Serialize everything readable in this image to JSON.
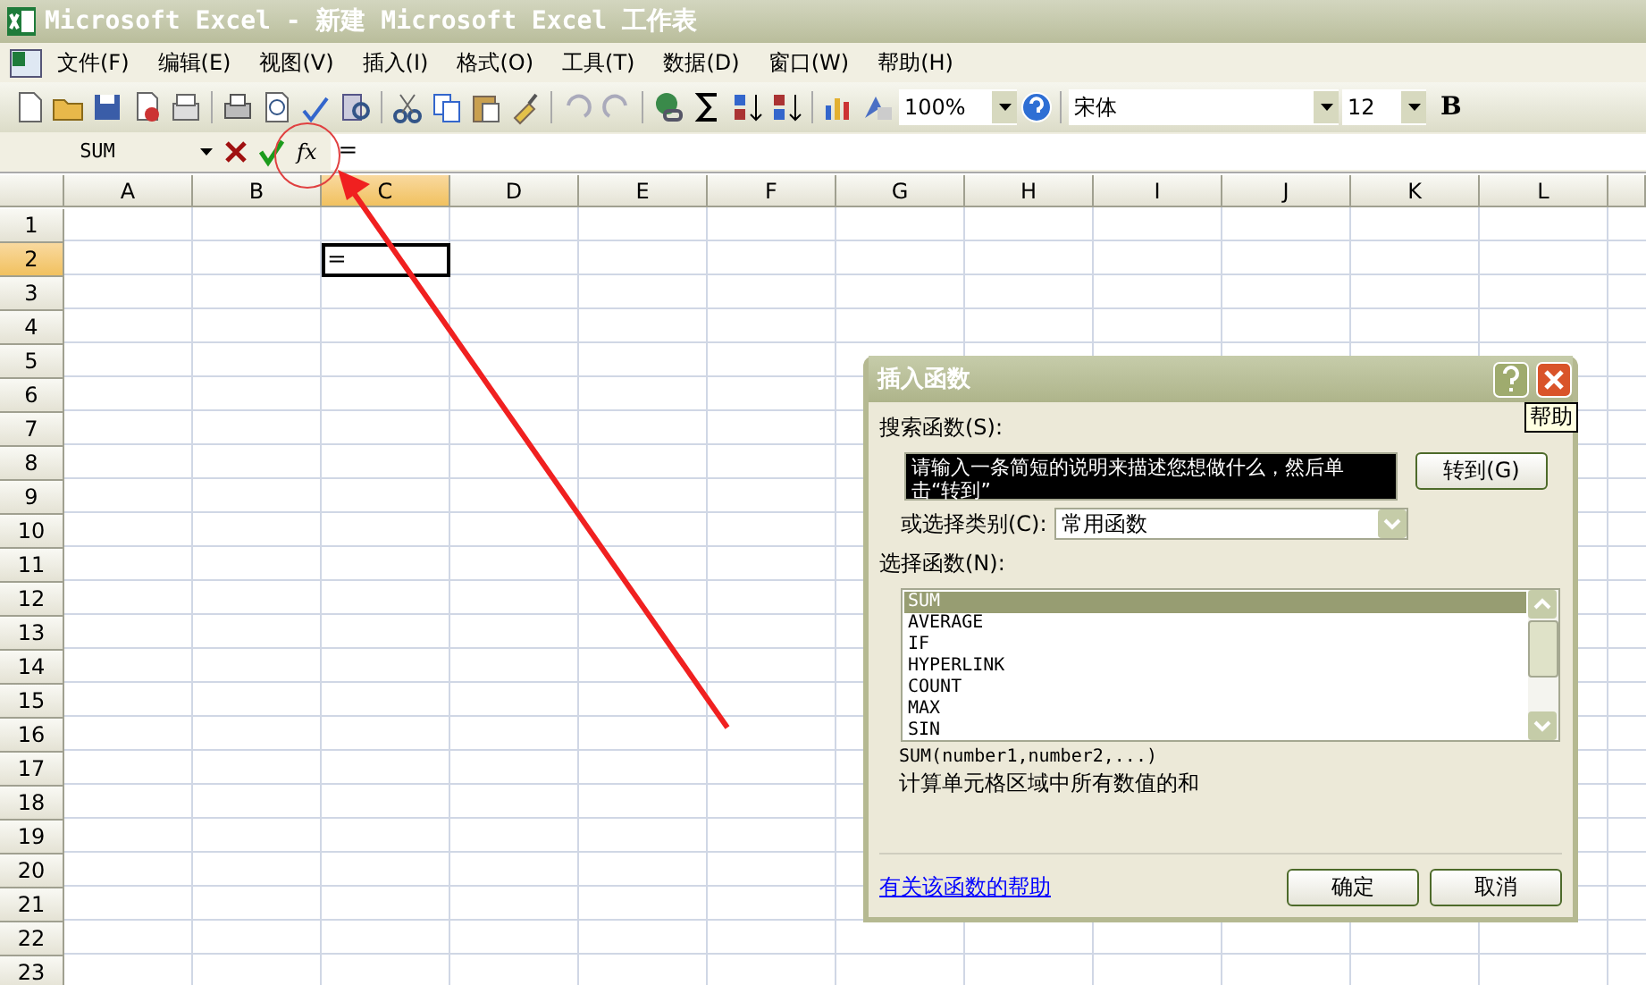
{
  "window": {
    "title": "Microsoft Excel - 新建 Microsoft Excel 工作表"
  },
  "menu": [
    "文件(F)",
    "编辑(E)",
    "视图(V)",
    "插入(I)",
    "格式(O)",
    "工具(T)",
    "数据(D)",
    "窗口(W)",
    "帮助(H)"
  ],
  "toolbar": {
    "zoom": "100%",
    "font": "宋体",
    "font_size": "12",
    "bold": "B"
  },
  "formula_bar": {
    "name_box": "SUM",
    "function_button": "fx",
    "formula": "="
  },
  "grid": {
    "columns": [
      {
        "label": "A",
        "selected": false
      },
      {
        "label": "B",
        "selected": false
      },
      {
        "label": "C",
        "selected": true
      },
      {
        "label": "D",
        "selected": false
      },
      {
        "label": "E",
        "selected": false
      },
      {
        "label": "F",
        "selected": false
      },
      {
        "label": "G",
        "selected": false
      },
      {
        "label": "H",
        "selected": false
      },
      {
        "label": "I",
        "selected": false
      },
      {
        "label": "J",
        "selected": false
      },
      {
        "label": "K",
        "selected": false
      },
      {
        "label": "L",
        "selected": false
      }
    ],
    "rows": [
      {
        "label": "1",
        "selected": false
      },
      {
        "label": "2",
        "selected": true
      },
      {
        "label": "3",
        "selected": false
      },
      {
        "label": "4",
        "selected": false
      },
      {
        "label": "5",
        "selected": false
      },
      {
        "label": "6",
        "selected": false
      },
      {
        "label": "7",
        "selected": false
      },
      {
        "label": "8",
        "selected": false
      },
      {
        "label": "9",
        "selected": false
      },
      {
        "label": "10",
        "selected": false
      },
      {
        "label": "11",
        "selected": false
      },
      {
        "label": "12",
        "selected": false
      },
      {
        "label": "13",
        "selected": false
      },
      {
        "label": "14",
        "selected": false
      },
      {
        "label": "15",
        "selected": false
      },
      {
        "label": "16",
        "selected": false
      },
      {
        "label": "17",
        "selected": false
      },
      {
        "label": "18",
        "selected": false
      },
      {
        "label": "19",
        "selected": false
      },
      {
        "label": "20",
        "selected": false
      },
      {
        "label": "21",
        "selected": false
      },
      {
        "label": "22",
        "selected": false
      },
      {
        "label": "23",
        "selected": false
      }
    ],
    "active_cell": {
      "value": "="
    }
  },
  "dialog": {
    "title": "插入函数",
    "help_tooltip": "帮助",
    "search_label": "搜索函数(S):",
    "search_value": "请输入一条简短的说明来描述您想做什么，然后单击“转到”",
    "search_text_selected": true,
    "go_button": "转到(G)",
    "category_label": "或选择类别(C):",
    "category_value": "常用函数",
    "function_label": "选择函数(N):",
    "functions": [
      {
        "name": "SUM",
        "selected": true
      },
      {
        "name": "AVERAGE",
        "selected": false
      },
      {
        "name": "IF",
        "selected": false
      },
      {
        "name": "HYPERLINK",
        "selected": false
      },
      {
        "name": "COUNT",
        "selected": false
      },
      {
        "name": "MAX",
        "selected": false
      },
      {
        "name": "SIN",
        "selected": false
      }
    ],
    "signature": "SUM(number1,number2,...)",
    "description": "计算单元格区域中所有数值的和",
    "help_link": "有关该函数的帮助",
    "buttons": [
      "确定",
      "取消"
    ]
  }
}
